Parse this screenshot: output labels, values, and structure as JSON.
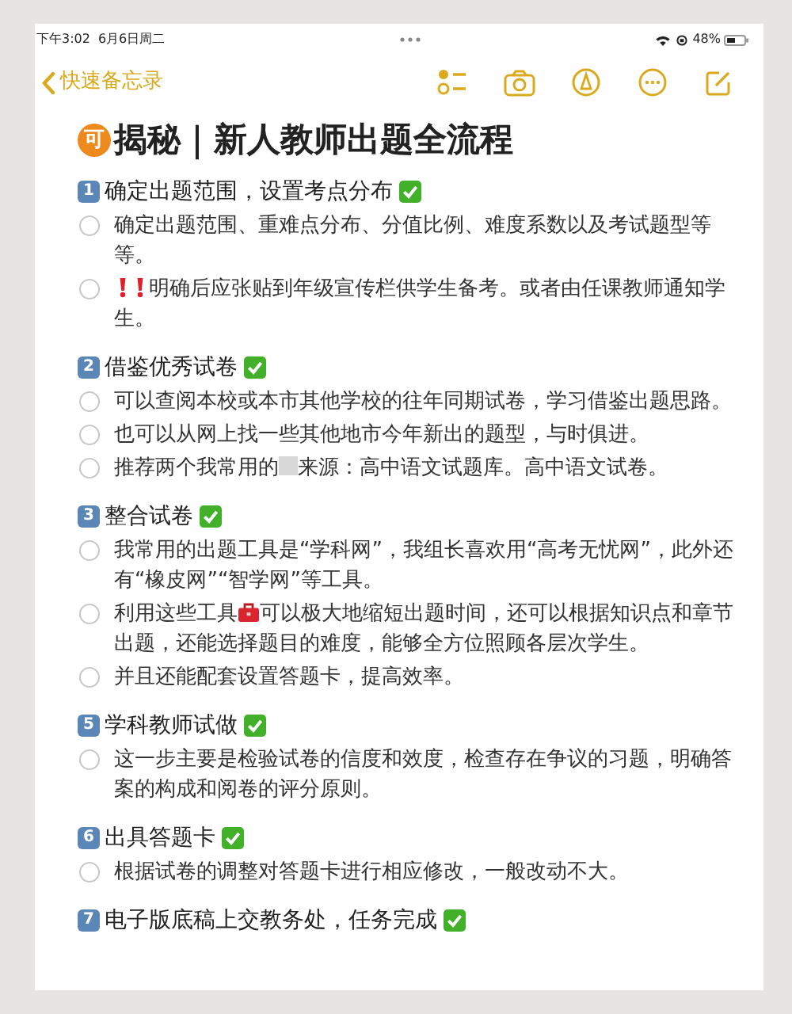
{
  "status_bar": {
    "time": "下午3:02",
    "date": "6月6日周二",
    "battery": "48%"
  },
  "nav": {
    "back_label": "快速备忘录"
  },
  "note": {
    "title_badge": "可",
    "title": "揭秘｜新人教师出题全流程",
    "sections": [
      {
        "number": "1",
        "heading": "确定出题范围，设置考点分布",
        "done": true,
        "items": [
          {
            "checked": false,
            "parts": [
              {
                "kind": "text",
                "text": "确定出题范围、重难点分布、分值比例、难度系数以及考试题型等等。"
              }
            ]
          },
          {
            "checked": false,
            "parts": [
              {
                "kind": "alert"
              },
              {
                "kind": "alert"
              },
              {
                "kind": "text",
                "text": "明确后应张贴到年级宣传栏供学生备考。或者由任课教师通知学生。"
              }
            ]
          }
        ]
      },
      {
        "number": "2",
        "heading": "借鉴优秀试卷",
        "done": true,
        "items": [
          {
            "checked": false,
            "parts": [
              {
                "kind": "text",
                "text": "可以查阅本校或本市其他学校的往年同期试卷，学习借鉴出题思路。"
              }
            ]
          },
          {
            "checked": false,
            "parts": [
              {
                "kind": "text",
                "text": "也可以从网上找一些其他地市今年新出的题型，与时俱进。"
              }
            ]
          },
          {
            "checked": false,
            "parts": [
              {
                "kind": "text",
                "text": "推荐两个我常用的"
              },
              {
                "kind": "blank"
              },
              {
                "kind": "text",
                "text": "来源：高中语文试题库。高中语文试卷。"
              }
            ]
          }
        ]
      },
      {
        "number": "3",
        "heading": "整合试卷",
        "done": true,
        "items": [
          {
            "checked": false,
            "parts": [
              {
                "kind": "text",
                "text": "我常用的出题工具是“学科网”，我组长喜欢用“高考无忧网”，此外还有“橡皮网”“智学网”等工具。"
              }
            ]
          },
          {
            "checked": false,
            "parts": [
              {
                "kind": "text",
                "text": "利用这些工具"
              },
              {
                "kind": "toolbox"
              },
              {
                "kind": "text",
                "text": "可以极大地缩短出题时间，还可以根据知识点和章节出题，还能选择题目的难度，能够全方位照顾各层次学生。"
              }
            ]
          },
          {
            "checked": false,
            "parts": [
              {
                "kind": "text",
                "text": "并且还能配套设置答题卡，提高效率。"
              }
            ]
          }
        ]
      },
      {
        "number": "5",
        "heading": "学科教师试做",
        "done": true,
        "items": [
          {
            "checked": false,
            "parts": [
              {
                "kind": "text",
                "text": "这一步主要是检验试卷的信度和效度，检查存在争议的习题，明确答案的构成和阅卷的评分原则。"
              }
            ]
          }
        ]
      },
      {
        "number": "6",
        "heading": "出具答题卡",
        "done": true,
        "items": [
          {
            "checked": false,
            "parts": [
              {
                "kind": "text",
                "text": "根据试卷的调整对答题卡进行相应修改，一般改动不大。"
              }
            ]
          }
        ]
      },
      {
        "number": "7",
        "heading": "电子版底稿上交教务处，任务完成",
        "done": true
      }
    ]
  }
}
